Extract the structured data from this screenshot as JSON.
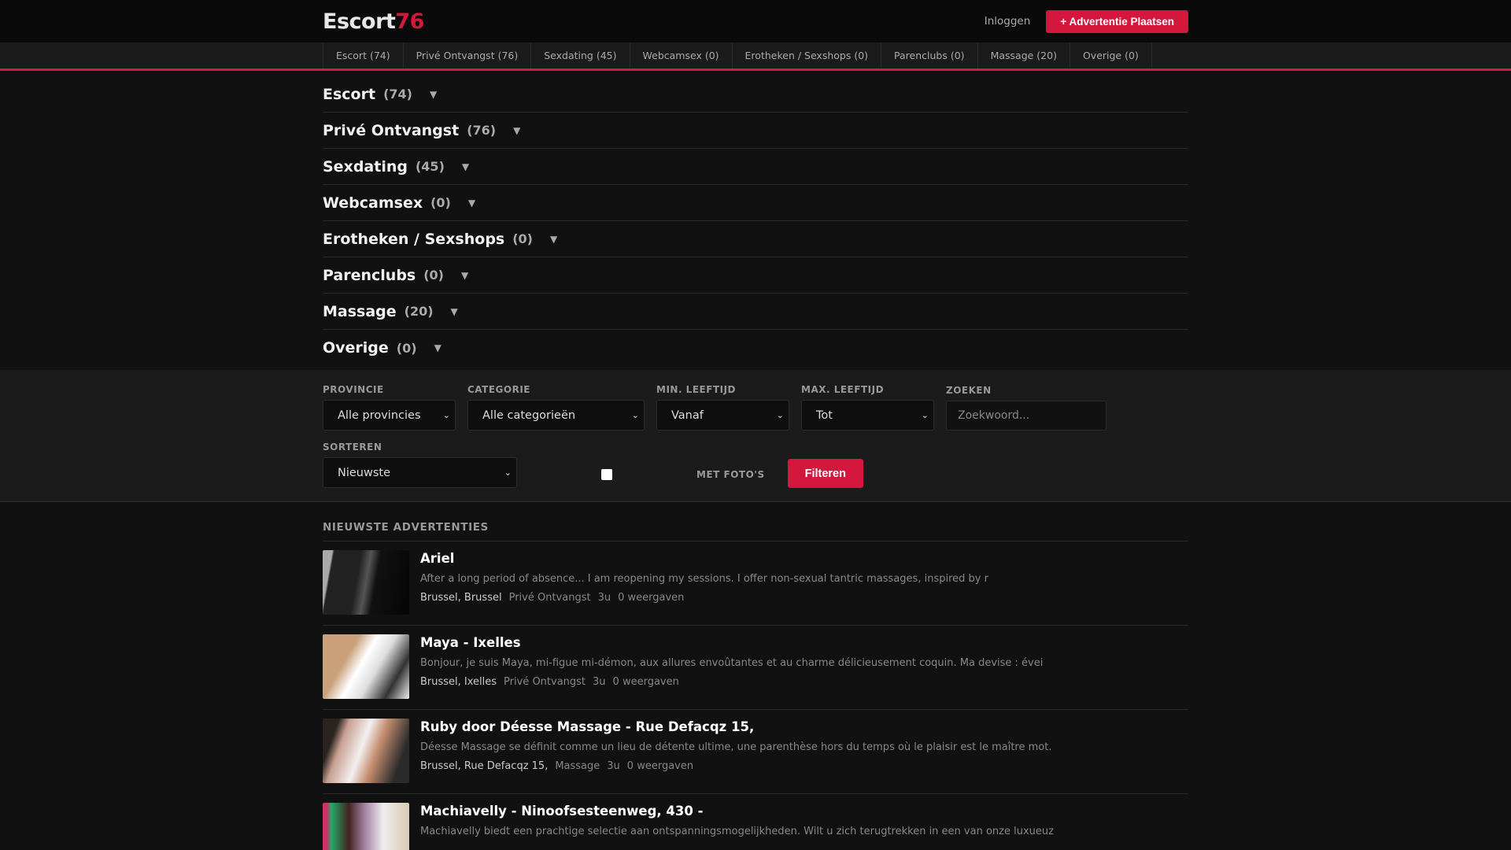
{
  "header": {
    "logo_text": "Escort",
    "logo_accent": "76",
    "login": "Inloggen",
    "post_button": "+ Advertentie Plaatsen"
  },
  "nav": [
    "Escort (74)",
    "Privé Ontvangst (76)",
    "Sexdating (45)",
    "Webcamsex (0)",
    "Erotheken / Sexshops (0)",
    "Parenclubs (0)",
    "Massage (20)",
    "Overige (0)"
  ],
  "categories": [
    {
      "name": "Escort",
      "count": "(74)"
    },
    {
      "name": "Privé Ontvangst",
      "count": "(76)"
    },
    {
      "name": "Sexdating",
      "count": "(45)"
    },
    {
      "name": "Webcamsex",
      "count": "(0)"
    },
    {
      "name": "Erotheken / Sexshops",
      "count": "(0)"
    },
    {
      "name": "Parenclubs",
      "count": "(0)"
    },
    {
      "name": "Massage",
      "count": "(20)"
    },
    {
      "name": "Overige",
      "count": "(0)"
    }
  ],
  "arrow": "▼",
  "filters": {
    "provincie_label": "PROVINCIE",
    "provincie_value": "Alle provincies",
    "categorie_label": "CATEGORIE",
    "categorie_value": "Alle categorieën",
    "min_label": "MIN. LEEFTIJD",
    "min_value": "Vanaf",
    "max_label": "MAX. LEEFTIJD",
    "max_value": "Tot",
    "zoeken_label": "ZOEKEN",
    "zoeken_placeholder": "Zoekwoord...",
    "sorteren_label": "SORTEREN",
    "sorteren_value": "Nieuwste",
    "foto_label": "MET FOTO'S",
    "filter_button": "Filteren"
  },
  "section_title": "NIEUWSTE ADVERTENTIES",
  "listings": [
    {
      "title": "Ariel",
      "desc": "After a long period of absence... I am reopening my sessions. I offer non-sexual tantric massages, inspired by r",
      "location": "Brussel, Brussel",
      "category": "Privé Ontvangst",
      "age": "3u",
      "views": "0 weergaven"
    },
    {
      "title": "Maya - Ixelles",
      "desc": "Bonjour, je suis Maya, mi-figue mi-démon, aux allures envoûtantes et au charme délicieusement coquin. Ma devise : évei",
      "location": "Brussel, Ixelles",
      "category": "Privé Ontvangst",
      "age": "3u",
      "views": "0 weergaven"
    },
    {
      "title": "Ruby door Déesse Massage - Rue Defacqz 15,",
      "desc": "Déesse Massage se définit comme un lieu de détente ultime, une parenthèse hors du temps où le plaisir est le maître mot.",
      "location": "Brussel, Rue Defacqz 15,",
      "category": "Massage",
      "age": "3u",
      "views": "0 weergaven"
    },
    {
      "title": "Machiavelly - Ninoofsesteenweg, 430 -",
      "desc": "Machiavelly biedt een prachtige selectie aan ontspanningsmogelijkheden. Wilt u zich terugtrekken in een van onze luxueuz",
      "location": "",
      "category": "",
      "age": "",
      "views": ""
    }
  ]
}
